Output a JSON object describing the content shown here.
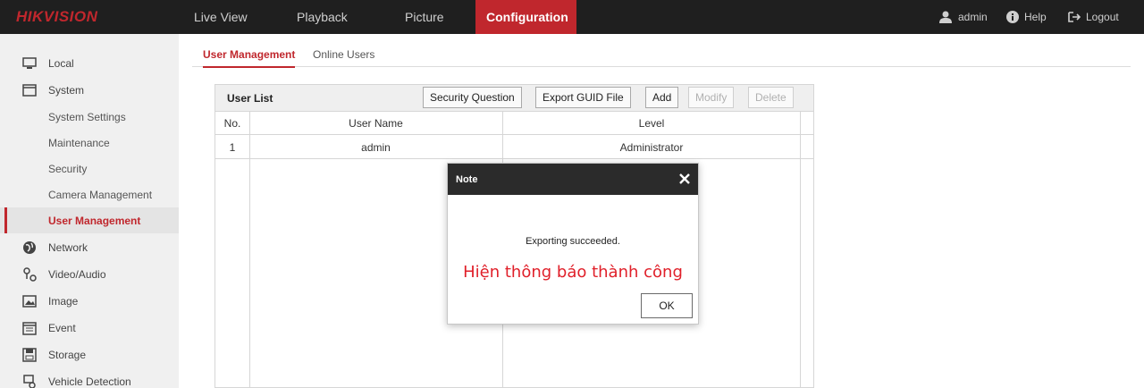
{
  "brand": {
    "logo": "HIKVISION",
    "accent": "#c0272d"
  },
  "nav": {
    "items": [
      "Live View",
      "Playback",
      "Picture",
      "Configuration"
    ],
    "active": "Configuration"
  },
  "top_right": {
    "user": "admin",
    "help": "Help",
    "logout": "Logout"
  },
  "sidebar": {
    "items": [
      {
        "label": "Local",
        "icon": "monitor-icon"
      },
      {
        "label": "System",
        "icon": "system-window-icon"
      },
      {
        "label": "System Settings"
      },
      {
        "label": "Maintenance"
      },
      {
        "label": "Security"
      },
      {
        "label": "Camera Management"
      },
      {
        "label": "User Management",
        "active": true
      },
      {
        "label": "Network",
        "icon": "globe-icon"
      },
      {
        "label": "Video/Audio",
        "icon": "video-audio-icon"
      },
      {
        "label": "Image",
        "icon": "image-icon"
      },
      {
        "label": "Event",
        "icon": "calendar-icon"
      },
      {
        "label": "Storage",
        "icon": "storage-icon"
      },
      {
        "label": "Vehicle Detection",
        "icon": "vehicle-detection-icon"
      }
    ]
  },
  "tabs": [
    "User Management",
    "Online Users"
  ],
  "user_list": {
    "title": "User List",
    "buttons": {
      "security_question": "Security Question",
      "export_guid": "Export GUID File",
      "add": "Add",
      "modify": "Modify",
      "delete": "Delete"
    },
    "columns": [
      "No.",
      "User Name",
      "Level"
    ],
    "rows": [
      {
        "no": "1",
        "user_name": "admin",
        "level": "Administrator"
      }
    ]
  },
  "modal": {
    "title": "Note",
    "message": "Exporting succeeded.",
    "annotation": "Hiện thông báo thành công",
    "ok_label": "OK"
  }
}
